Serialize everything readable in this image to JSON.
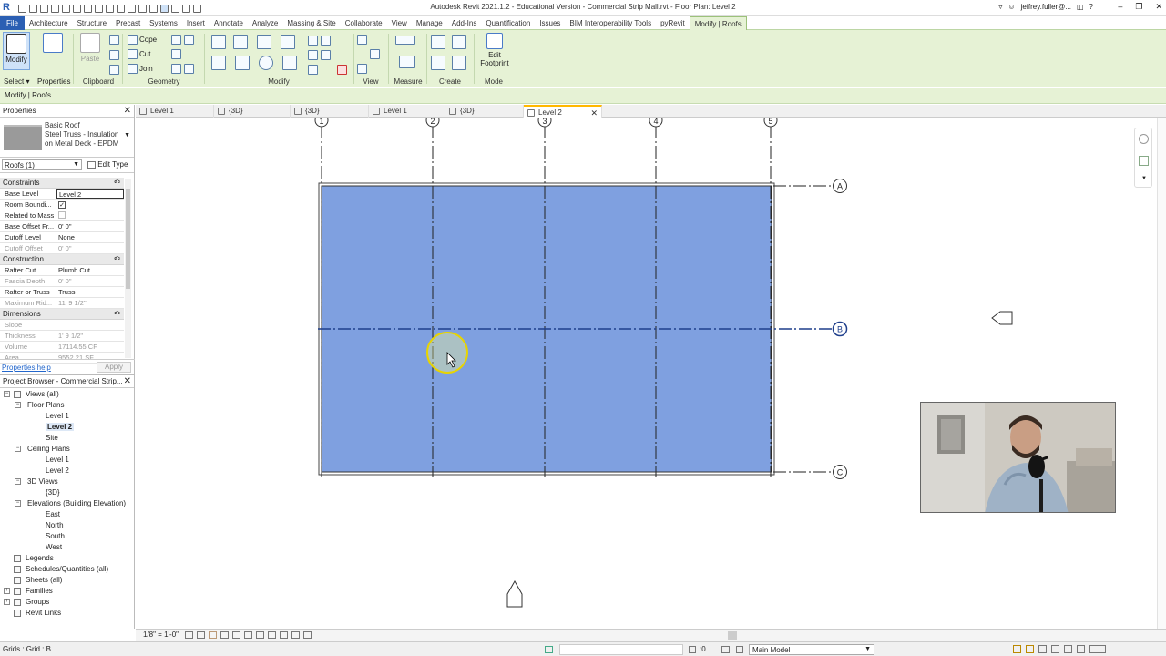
{
  "app": {
    "logo": "R",
    "title": "Autodesk Revit 2021.1.2 - Educational Version - Commercial Strip Mall.rvt - Floor Plan: Level 2",
    "user": "jeffrey.fuller@...",
    "minimize": "–",
    "restore": "❐",
    "close": "✕"
  },
  "ribbon_tabs": [
    "File",
    "Architecture",
    "Structure",
    "Precast",
    "Systems",
    "Insert",
    "Annotate",
    "Analyze",
    "Massing & Site",
    "Collaborate",
    "View",
    "Manage",
    "Add-Ins",
    "Quantification",
    "Issues",
    "BIM Interoperability Tools",
    "pyRevit",
    "Modify | Roofs"
  ],
  "ribbon": {
    "modify_label": "Modify",
    "select_label": "Select ▾",
    "properties_label": "Properties",
    "paste_label": "Paste",
    "clipboard_label": "Clipboard",
    "cope_label": "Cope",
    "cut_label": "Cut",
    "join_label": "Join",
    "geometry_label": "Geometry",
    "modify_panel_label": "Modify",
    "view_label": "View",
    "measure_label": "Measure",
    "create_label": "Create",
    "edit_footprint_line1": "Edit",
    "edit_footprint_line2": "Footprint",
    "mode_label": "Mode"
  },
  "options_bar": {
    "context": "Modify | Roofs"
  },
  "properties": {
    "title": "Properties",
    "type_family": "Basic Roof",
    "type_name_1": "Steel Truss - Insulation",
    "type_name_2": "on Metal Deck - EPDM",
    "instance_filter": "Roofs (1)",
    "edit_type": "Edit Type",
    "groups": [
      {
        "name": "Constraints",
        "rows": [
          {
            "key": "Base Level",
            "value": "Level 2",
            "state": "input"
          },
          {
            "key": "Room Boundi...",
            "value": "✓",
            "state": "check"
          },
          {
            "key": "Related to Mass",
            "value": "",
            "state": "check-off"
          },
          {
            "key": "Base Offset Fr...",
            "value": "0'  0\"",
            "state": "normal"
          },
          {
            "key": "Cutoff Level",
            "value": "None",
            "state": "normal"
          },
          {
            "key": "Cutoff Offset",
            "value": "0'  0\"",
            "state": "dim"
          }
        ]
      },
      {
        "name": "Construction",
        "rows": [
          {
            "key": "Rafter Cut",
            "value": "Plumb Cut",
            "state": "normal"
          },
          {
            "key": "Fascia Depth",
            "value": "0'  0\"",
            "state": "dim"
          },
          {
            "key": "Rafter or Truss",
            "value": "Truss",
            "state": "normal"
          },
          {
            "key": "Maximum Rid...",
            "value": "11'  9 1/2\"",
            "state": "dim"
          }
        ]
      },
      {
        "name": "Dimensions",
        "rows": [
          {
            "key": "Slope",
            "value": "",
            "state": "dim"
          },
          {
            "key": "Thickness",
            "value": "1'  9 1/2\"",
            "state": "dim"
          },
          {
            "key": "Volume",
            "value": "17114.55 CF",
            "state": "dim"
          },
          {
            "key": "Area",
            "value": "9552.21 SF",
            "state": "dim"
          }
        ]
      }
    ],
    "help_link": "Properties help",
    "apply": "Apply"
  },
  "project_browser": {
    "title": "Project Browser - Commercial Strip...",
    "nodes": [
      {
        "label": "Views (all)",
        "level": 0,
        "toggle": "−",
        "icon": true
      },
      {
        "label": "Floor Plans",
        "level": 1,
        "toggle": "−"
      },
      {
        "label": "Level 1",
        "level": 2
      },
      {
        "label": "Level 2",
        "level": 2,
        "bold": true
      },
      {
        "label": "Site",
        "level": 2
      },
      {
        "label": "Ceiling Plans",
        "level": 1,
        "toggle": "−"
      },
      {
        "label": "Level 1",
        "level": 2
      },
      {
        "label": "Level 2",
        "level": 2
      },
      {
        "label": "3D Views",
        "level": 1,
        "toggle": "−"
      },
      {
        "label": "{3D}",
        "level": 2
      },
      {
        "label": "Elevations (Building Elevation)",
        "level": 1,
        "toggle": "−"
      },
      {
        "label": "East",
        "level": 2
      },
      {
        "label": "North",
        "level": 2
      },
      {
        "label": "South",
        "level": 2
      },
      {
        "label": "West",
        "level": 2
      },
      {
        "label": "Legends",
        "level": 0,
        "icon": true
      },
      {
        "label": "Schedules/Quantities (all)",
        "level": 0,
        "icon": true
      },
      {
        "label": "Sheets (all)",
        "level": 0,
        "icon": true
      },
      {
        "label": "Families",
        "level": 0,
        "toggle": "+",
        "icon": true
      },
      {
        "label": "Groups",
        "level": 0,
        "toggle": "+",
        "icon": true
      },
      {
        "label": "Revit Links",
        "level": 0,
        "icon": true
      }
    ]
  },
  "view_tabs": [
    {
      "label": "Level 1",
      "icon": "floor-plan-icon"
    },
    {
      "label": "{3D}",
      "icon": "3d-view-icon"
    },
    {
      "label": "{3D}",
      "icon": "3d-view-icon"
    },
    {
      "label": "Level 1",
      "icon": "floor-plan-icon"
    },
    {
      "label": "{3D}",
      "icon": "3d-view-icon"
    },
    {
      "label": "Level 2",
      "icon": "floor-plan-icon",
      "active": true
    }
  ],
  "grids": {
    "vertical": [
      "1",
      "2",
      "3",
      "4",
      "5"
    ],
    "horizontal": [
      "A",
      "B",
      "C"
    ],
    "selected": "B"
  },
  "roof_color": "#7fa0e0",
  "view_bar": {
    "scale": "1/8\" = 1'-0\""
  },
  "status_bar": {
    "message": "Grids : Grid : B",
    "zero": ":0",
    "model": "Main Model"
  }
}
